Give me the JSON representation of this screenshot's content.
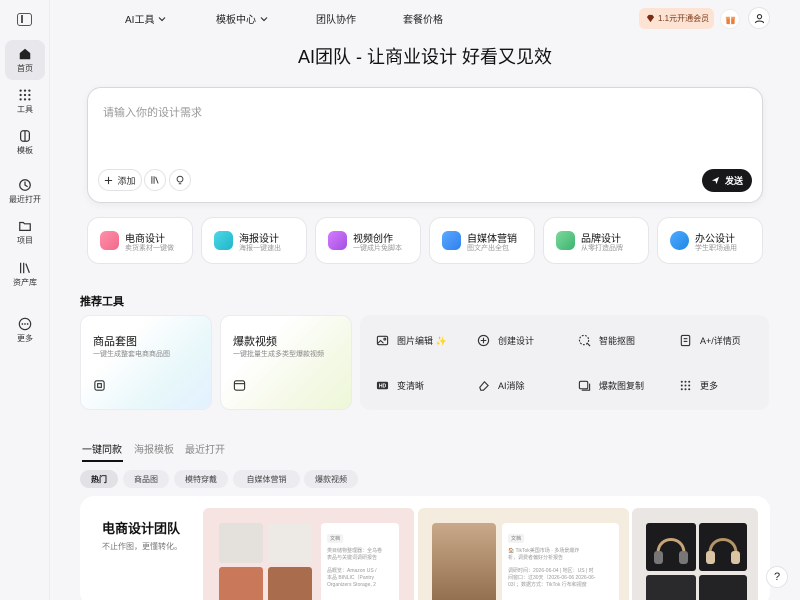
{
  "sidebar": {
    "items": [
      {
        "label": "首页",
        "icon": "home-icon"
      },
      {
        "label": "工具",
        "icon": "grid-icon"
      },
      {
        "label": "模板",
        "icon": "template-icon"
      },
      {
        "label": "最近打开",
        "icon": "clock-icon"
      },
      {
        "label": "项目",
        "icon": "folder-icon"
      },
      {
        "label": "资产库",
        "icon": "library-icon"
      },
      {
        "label": "更多",
        "icon": "more-icon"
      }
    ]
  },
  "topnav": {
    "items": [
      {
        "label": "AI工具"
      },
      {
        "label": "模板中心"
      },
      {
        "label": "团队协作"
      },
      {
        "label": "套餐价格"
      }
    ],
    "promo": "1.1元开通会员"
  },
  "hero": {
    "title": "AI团队 - 让商业设计 好看又见效"
  },
  "prompt": {
    "placeholder": "请输入你的设计需求",
    "add_label": "添加",
    "send_label": "发送"
  },
  "categories": [
    {
      "title": "电商设计",
      "sub": "卖货素材一键做",
      "color": "#f06a8a"
    },
    {
      "title": "海报设计",
      "sub": "海报一键速出",
      "color": "#1fb6c9"
    },
    {
      "title": "视频创作",
      "sub": "一键成片免脚本",
      "color": "#a24ee0"
    },
    {
      "title": "自媒体营销",
      "sub": "图文产出全包",
      "color": "#2f80ed"
    },
    {
      "title": "品牌设计",
      "sub": "从零打造品牌",
      "color": "#3cb371"
    },
    {
      "title": "办公设计",
      "sub": "学生职场通用",
      "color": "#1e88e5"
    }
  ],
  "recommended": {
    "title": "推荐工具",
    "featured": [
      {
        "title": "商品套图",
        "sub": "一键生成整套电商商品图"
      },
      {
        "title": "爆款视频",
        "sub": "一键批量生成多类型爆款视频"
      }
    ],
    "tools": [
      {
        "label": "图片编辑 ✨",
        "icon": "image-edit-icon"
      },
      {
        "label": "创建设计",
        "icon": "plus-square-icon"
      },
      {
        "label": "智能抠图",
        "icon": "cutout-icon"
      },
      {
        "label": "A+/详情页",
        "icon": "detail-page-icon"
      },
      {
        "label": "变清晰",
        "icon": "hd-icon"
      },
      {
        "label": "AI消除",
        "icon": "eraser-icon"
      },
      {
        "label": "爆款图复制",
        "icon": "copy-image-icon"
      },
      {
        "label": "更多",
        "icon": "grid-dots-icon"
      }
    ]
  },
  "tabs": [
    "一键同款",
    "海报模板",
    "最近打开"
  ],
  "filters": [
    "热门",
    "商品图",
    "模特穿戴",
    "自媒体营销",
    "爆款视频"
  ],
  "showcase": {
    "title": "电商设计团队",
    "sub": "不止作图，更懂转化。",
    "doc_tag": "文档",
    "doc1_lines": [
      "类目储物整理器：全乌卷",
      "表品与关键词调研报告",
      "",
      "品概览：Amazon US /",
      "本品 BINLIC（Pantry",
      "Organizers Storage, 2"
    ],
    "doc2_lines": [
      "🏠 TikTok美国市场 · 多场景爆炸",
      "析，调费者偏好分析报告",
      "",
      "调研时间：2026-06-04 | 地区：US | 时",
      "间窗口：过30天（2026-06-06 2026-06-",
      "03）；数据方式：TikTok 行布和视度"
    ]
  },
  "help": "?"
}
